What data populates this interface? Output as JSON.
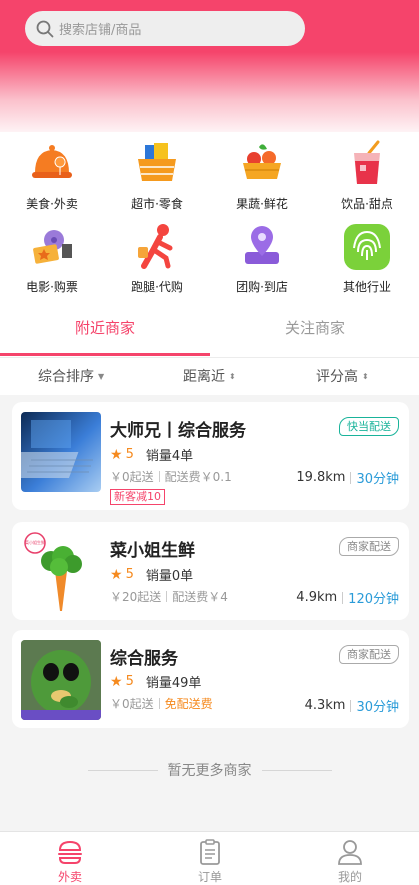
{
  "search": {
    "placeholder": "搜索店铺/商品"
  },
  "categories": [
    {
      "label": "美食·外卖",
      "icon": "food-cloche-icon"
    },
    {
      "label": "超市·零食",
      "icon": "supermarket-basket-icon"
    },
    {
      "label": "果蔬·鲜花",
      "icon": "fruit-basket-icon"
    },
    {
      "label": "饮品·甜点",
      "icon": "drink-cup-icon"
    },
    {
      "label": "电影·购票",
      "icon": "movie-ticket-icon"
    },
    {
      "label": "跑腿·代购",
      "icon": "runner-icon"
    },
    {
      "label": "团购·到店",
      "icon": "location-pin-icon"
    },
    {
      "label": "其他行业",
      "icon": "fingerprint-icon"
    }
  ],
  "tabs": {
    "nearby": "附近商家",
    "followed": "关注商家"
  },
  "sort": {
    "comprehensive": "综合排序",
    "distance": "距离近",
    "rating": "评分高"
  },
  "stores": [
    {
      "name": "大师兄丨综合服务",
      "badge": "快当配送",
      "rating": "5",
      "sales": "销量4单",
      "min_order": "￥0起送",
      "delivery_fee": "配送费￥0.1",
      "distance": "19.8km",
      "time": "30分钟",
      "promo": "新客减10"
    },
    {
      "name": "菜小姐生鲜",
      "badge": "商家配送",
      "rating": "5",
      "sales": "销量0单",
      "min_order": "￥20起送",
      "delivery_fee": "配送费￥4",
      "distance": "4.9km",
      "time": "120分钟",
      "logo_text": "菜小姐生鲜"
    },
    {
      "name": "综合服务",
      "badge": "商家配送",
      "rating": "5",
      "sales": "销量49单",
      "min_order": "￥0起送",
      "delivery_fee": "免配送费",
      "distance": "4.3km",
      "time": "30分钟"
    }
  ],
  "no_more": "暂无更多商家",
  "nav": {
    "takeout": "外卖",
    "orders": "订单",
    "mine": "我的"
  },
  "colors": {
    "accent": "#f5446b",
    "star": "#f58a1f",
    "time": "#2a9bd8",
    "fast_badge": "#19b39a"
  }
}
